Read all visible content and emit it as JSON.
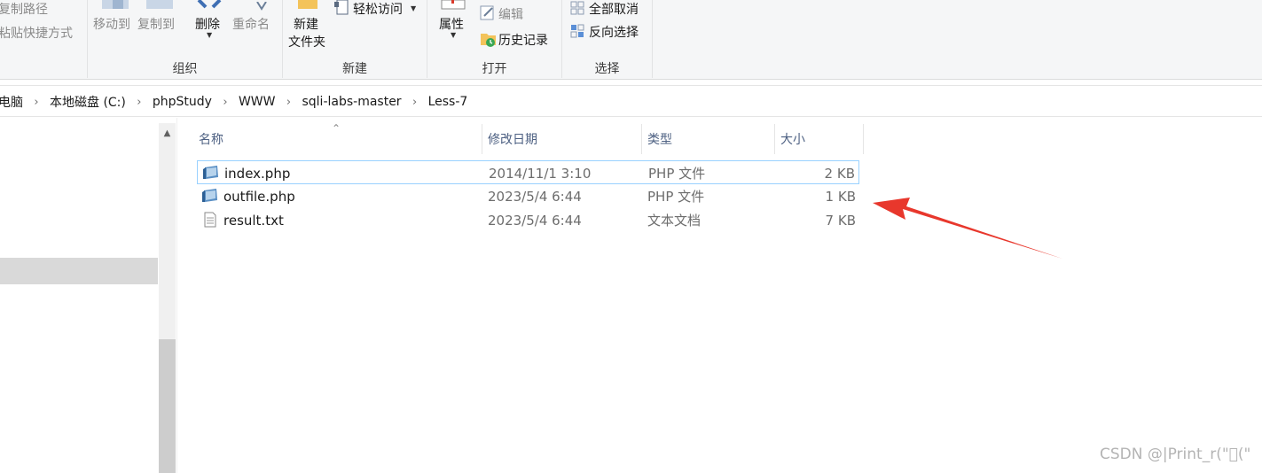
{
  "ribbon": {
    "clipboard": {
      "copy_path": "复制路径",
      "paste_shortcut": "粘贴快捷方式"
    },
    "organize": {
      "move_to": "移动到",
      "copy_to": "复制到",
      "delete": "删除",
      "rename": "重命名",
      "group_label": "组织"
    },
    "new": {
      "new_folder_line1": "新建",
      "new_folder_line2": "文件夹",
      "easy_access": "轻松访问",
      "group_label": "新建"
    },
    "open": {
      "properties": "属性",
      "edit": "编辑",
      "history": "历史记录",
      "group_label": "打开"
    },
    "select": {
      "select_none": "全部取消",
      "invert_selection": "反向选择",
      "group_label": "选择"
    }
  },
  "address": {
    "crumbs": [
      "电脑",
      "本地磁盘 (C:)",
      "phpStudy",
      "WWW",
      "sqli-labs-master",
      "Less-7"
    ]
  },
  "columns": {
    "name": "名称",
    "date": "修改日期",
    "type": "类型",
    "size": "大小"
  },
  "files": [
    {
      "name": "index.php",
      "date": "2014/11/1 3:10",
      "type": "PHP 文件",
      "size": "2 KB",
      "icon": "php-file-icon"
    },
    {
      "name": "outfile.php",
      "date": "2023/5/4 6:44",
      "type": "PHP 文件",
      "size": "1 KB",
      "icon": "php-file-icon"
    },
    {
      "name": "result.txt",
      "date": "2023/5/4 6:44",
      "type": "文本文档",
      "size": "7 KB",
      "icon": "text-file-icon"
    }
  ],
  "watermark": "CSDN @|Print_r(\"\u0000(\"",
  "colors": {
    "annotation_arrow": "#e8372c",
    "hover_border": "#99d1ff",
    "header_text": "#4d6082"
  }
}
